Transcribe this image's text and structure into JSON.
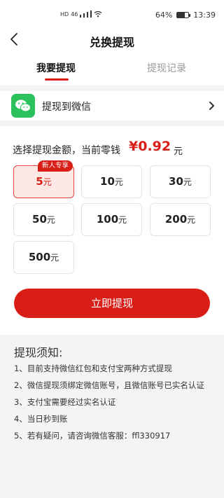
{
  "status_bar": {
    "network": "HD",
    "signal_mark": "46",
    "battery_percent": "64%",
    "battery_level": 0.64,
    "time": "13:39"
  },
  "header": {
    "title": "兑换提现"
  },
  "tabs": [
    {
      "label": "我要提现",
      "active": true
    },
    {
      "label": "提现记录",
      "active": false
    }
  ],
  "method": {
    "label": "提现到微信",
    "icon": "wechat-icon"
  },
  "amount": {
    "title": "选择提现金额，当前零钱",
    "balance": "¥0.92",
    "unit": "元"
  },
  "options": [
    {
      "value": "5",
      "unit": "元",
      "selected": true,
      "badge": "新人专享"
    },
    {
      "value": "10",
      "unit": "元"
    },
    {
      "value": "30",
      "unit": "元"
    },
    {
      "value": "50",
      "unit": "元"
    },
    {
      "value": "100",
      "unit": "元"
    },
    {
      "value": "200",
      "unit": "元"
    },
    {
      "value": "500",
      "unit": "元"
    }
  ],
  "submit_label": "立即提现",
  "notes": {
    "title": "提现须知:",
    "items": [
      "1、目前支持微信红包和支付宝两种方式提现",
      "2、微信提现须绑定微信账号，且微信账号已实名认证",
      "3、支付宝需要经过实名认证",
      "4、当日秒到账",
      "5、若有疑问，请咨询微信客服：ffl330917"
    ]
  },
  "colors": {
    "accent": "#d91e18",
    "wechat_green": "#2bc15c",
    "page_bg": "#f4f4f6"
  }
}
